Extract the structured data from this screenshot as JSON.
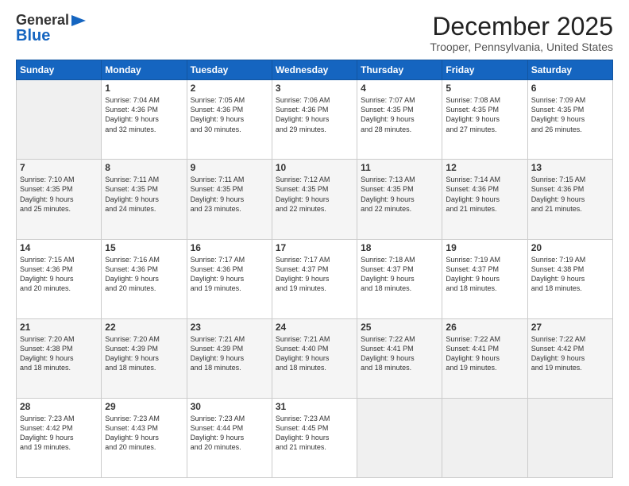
{
  "logo": {
    "general": "General",
    "blue": "Blue"
  },
  "title": "December 2025",
  "subtitle": "Trooper, Pennsylvania, United States",
  "days_of_week": [
    "Sunday",
    "Monday",
    "Tuesday",
    "Wednesday",
    "Thursday",
    "Friday",
    "Saturday"
  ],
  "weeks": [
    [
      {
        "day": "",
        "info": ""
      },
      {
        "day": "1",
        "info": "Sunrise: 7:04 AM\nSunset: 4:36 PM\nDaylight: 9 hours\nand 32 minutes."
      },
      {
        "day": "2",
        "info": "Sunrise: 7:05 AM\nSunset: 4:36 PM\nDaylight: 9 hours\nand 30 minutes."
      },
      {
        "day": "3",
        "info": "Sunrise: 7:06 AM\nSunset: 4:36 PM\nDaylight: 9 hours\nand 29 minutes."
      },
      {
        "day": "4",
        "info": "Sunrise: 7:07 AM\nSunset: 4:35 PM\nDaylight: 9 hours\nand 28 minutes."
      },
      {
        "day": "5",
        "info": "Sunrise: 7:08 AM\nSunset: 4:35 PM\nDaylight: 9 hours\nand 27 minutes."
      },
      {
        "day": "6",
        "info": "Sunrise: 7:09 AM\nSunset: 4:35 PM\nDaylight: 9 hours\nand 26 minutes."
      }
    ],
    [
      {
        "day": "7",
        "info": "Sunrise: 7:10 AM\nSunset: 4:35 PM\nDaylight: 9 hours\nand 25 minutes."
      },
      {
        "day": "8",
        "info": "Sunrise: 7:11 AM\nSunset: 4:35 PM\nDaylight: 9 hours\nand 24 minutes."
      },
      {
        "day": "9",
        "info": "Sunrise: 7:11 AM\nSunset: 4:35 PM\nDaylight: 9 hours\nand 23 minutes."
      },
      {
        "day": "10",
        "info": "Sunrise: 7:12 AM\nSunset: 4:35 PM\nDaylight: 9 hours\nand 22 minutes."
      },
      {
        "day": "11",
        "info": "Sunrise: 7:13 AM\nSunset: 4:35 PM\nDaylight: 9 hours\nand 22 minutes."
      },
      {
        "day": "12",
        "info": "Sunrise: 7:14 AM\nSunset: 4:36 PM\nDaylight: 9 hours\nand 21 minutes."
      },
      {
        "day": "13",
        "info": "Sunrise: 7:15 AM\nSunset: 4:36 PM\nDaylight: 9 hours\nand 21 minutes."
      }
    ],
    [
      {
        "day": "14",
        "info": "Sunrise: 7:15 AM\nSunset: 4:36 PM\nDaylight: 9 hours\nand 20 minutes."
      },
      {
        "day": "15",
        "info": "Sunrise: 7:16 AM\nSunset: 4:36 PM\nDaylight: 9 hours\nand 20 minutes."
      },
      {
        "day": "16",
        "info": "Sunrise: 7:17 AM\nSunset: 4:36 PM\nDaylight: 9 hours\nand 19 minutes."
      },
      {
        "day": "17",
        "info": "Sunrise: 7:17 AM\nSunset: 4:37 PM\nDaylight: 9 hours\nand 19 minutes."
      },
      {
        "day": "18",
        "info": "Sunrise: 7:18 AM\nSunset: 4:37 PM\nDaylight: 9 hours\nand 18 minutes."
      },
      {
        "day": "19",
        "info": "Sunrise: 7:19 AM\nSunset: 4:37 PM\nDaylight: 9 hours\nand 18 minutes."
      },
      {
        "day": "20",
        "info": "Sunrise: 7:19 AM\nSunset: 4:38 PM\nDaylight: 9 hours\nand 18 minutes."
      }
    ],
    [
      {
        "day": "21",
        "info": "Sunrise: 7:20 AM\nSunset: 4:38 PM\nDaylight: 9 hours\nand 18 minutes."
      },
      {
        "day": "22",
        "info": "Sunrise: 7:20 AM\nSunset: 4:39 PM\nDaylight: 9 hours\nand 18 minutes."
      },
      {
        "day": "23",
        "info": "Sunrise: 7:21 AM\nSunset: 4:39 PM\nDaylight: 9 hours\nand 18 minutes."
      },
      {
        "day": "24",
        "info": "Sunrise: 7:21 AM\nSunset: 4:40 PM\nDaylight: 9 hours\nand 18 minutes."
      },
      {
        "day": "25",
        "info": "Sunrise: 7:22 AM\nSunset: 4:41 PM\nDaylight: 9 hours\nand 18 minutes."
      },
      {
        "day": "26",
        "info": "Sunrise: 7:22 AM\nSunset: 4:41 PM\nDaylight: 9 hours\nand 19 minutes."
      },
      {
        "day": "27",
        "info": "Sunrise: 7:22 AM\nSunset: 4:42 PM\nDaylight: 9 hours\nand 19 minutes."
      }
    ],
    [
      {
        "day": "28",
        "info": "Sunrise: 7:23 AM\nSunset: 4:42 PM\nDaylight: 9 hours\nand 19 minutes."
      },
      {
        "day": "29",
        "info": "Sunrise: 7:23 AM\nSunset: 4:43 PM\nDaylight: 9 hours\nand 20 minutes."
      },
      {
        "day": "30",
        "info": "Sunrise: 7:23 AM\nSunset: 4:44 PM\nDaylight: 9 hours\nand 20 minutes."
      },
      {
        "day": "31",
        "info": "Sunrise: 7:23 AM\nSunset: 4:45 PM\nDaylight: 9 hours\nand 21 minutes."
      },
      {
        "day": "",
        "info": ""
      },
      {
        "day": "",
        "info": ""
      },
      {
        "day": "",
        "info": ""
      }
    ]
  ]
}
